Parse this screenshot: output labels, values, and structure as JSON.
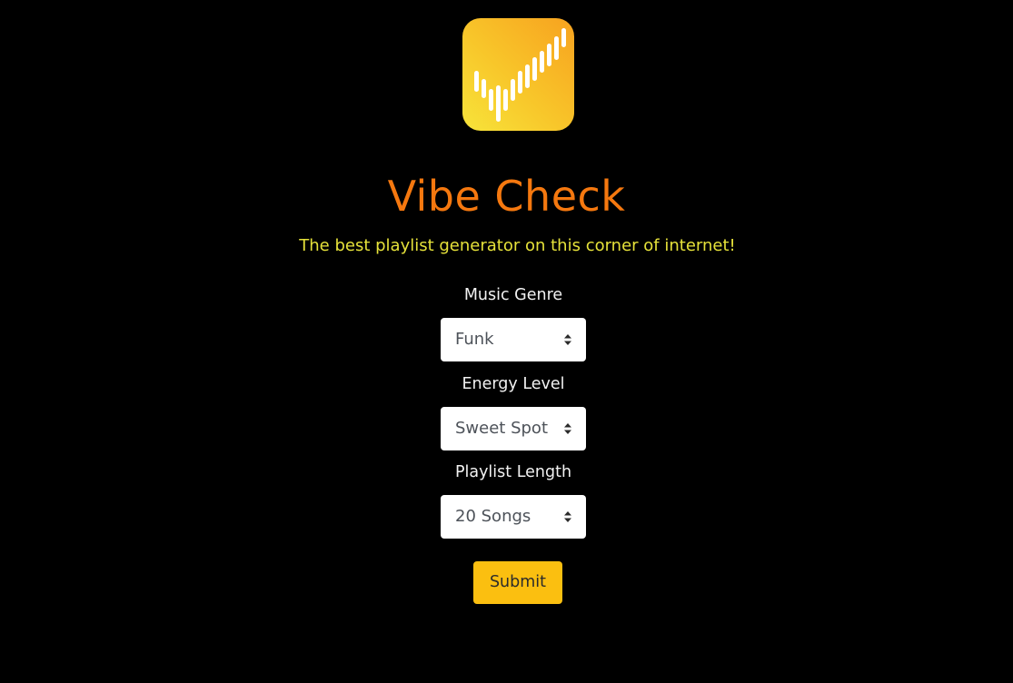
{
  "app": {
    "title": "Vibe Check",
    "subtitle": "The best playlist generator on this corner of internet!",
    "logo_icon": "vibe-check-logo-icon"
  },
  "form": {
    "genre": {
      "label": "Music Genre",
      "value": "Funk"
    },
    "energy": {
      "label": "Energy Level",
      "value": "Sweet Spot"
    },
    "length": {
      "label": "Playlist Length",
      "value": "20 Songs"
    },
    "submit_label": "Submit"
  },
  "colors": {
    "background": "#000000",
    "title": "#f5780f",
    "subtitle": "#e6e23a",
    "label": "#f2f2f2",
    "submit_button": "#fbbf10",
    "logo_gradient": [
      "#f7a21f",
      "#f7e43a"
    ]
  }
}
